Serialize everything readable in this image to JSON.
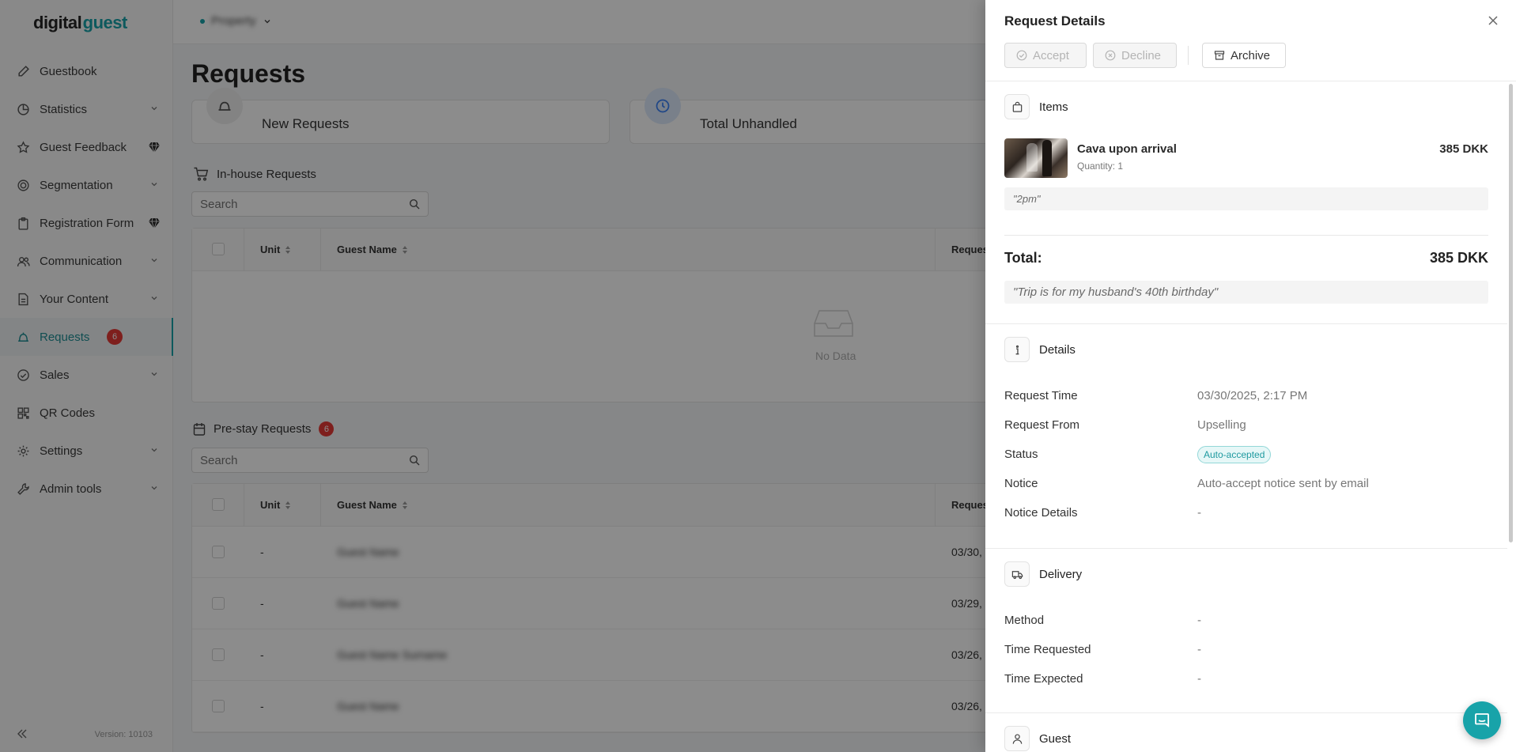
{
  "brand": {
    "logo_main": "digital",
    "logo_accent": "guest"
  },
  "header": {
    "property_name": "Property"
  },
  "sidebar": {
    "items": [
      {
        "label": "Guestbook",
        "icon": "pen-icon"
      },
      {
        "label": "Statistics",
        "icon": "chart-icon"
      },
      {
        "label": "Guest Feedback",
        "icon": "star-icon"
      },
      {
        "label": "Segmentation",
        "icon": "target-icon"
      },
      {
        "label": "Registration Form",
        "icon": "clipboard-icon"
      },
      {
        "label": "Communication",
        "icon": "users-icon"
      },
      {
        "label": "Your Content",
        "icon": "document-icon"
      },
      {
        "label": "Requests",
        "icon": "bell-icon",
        "badge": "6"
      },
      {
        "label": "Sales",
        "icon": "bag-icon"
      },
      {
        "label": "QR Codes",
        "icon": "qr-icon"
      },
      {
        "label": "Settings",
        "icon": "gear-icon"
      },
      {
        "label": "Admin tools",
        "icon": "wrench-icon"
      }
    ],
    "version": "Version: 10103"
  },
  "main": {
    "title": "Requests",
    "cards": {
      "new_requests": "New Requests",
      "total_unhandled": "Total Unhandled"
    },
    "inhouse": {
      "title": "In-house Requests",
      "search_placeholder": "Search",
      "columns": {
        "unit": "Unit",
        "guest_name": "Guest Name",
        "request": "Reques"
      },
      "empty_text": "No Data"
    },
    "prestay": {
      "title": "Pre-stay Requests",
      "badge": "6",
      "search_placeholder": "Search",
      "columns": {
        "unit": "Unit",
        "guest_name": "Guest Name",
        "request": "Reques"
      },
      "rows": [
        {
          "unit": "-",
          "guest_name": "Guest Name",
          "date": "03/30,"
        },
        {
          "unit": "-",
          "guest_name": "Guest Name",
          "date": "03/29,"
        },
        {
          "unit": "-",
          "guest_name": "Guest Name Surname",
          "date": "03/26,"
        },
        {
          "unit": "-",
          "guest_name": "Guest Name",
          "date": "03/26,"
        }
      ]
    }
  },
  "drawer": {
    "title": "Request Details",
    "actions": {
      "accept": "Accept",
      "decline": "Decline",
      "archive": "Archive"
    },
    "items_section": {
      "title": "Items",
      "item_name": "Cava upon arrival",
      "item_quantity": "Quantity: 1",
      "item_price": "385 DKK",
      "item_note": "\"2pm\"",
      "total_label": "Total:",
      "total_value": "385 DKK",
      "order_note": "\"Trip is for my husband's 40th birthday\""
    },
    "details_section": {
      "title": "Details",
      "request_time_label": "Request Time",
      "request_time_value": "03/30/2025, 2:17 PM",
      "request_from_label": "Request From",
      "request_from_value": "Upselling",
      "status_label": "Status",
      "status_value": "Auto-accepted",
      "notice_label": "Notice",
      "notice_value": "Auto-accept notice sent by email",
      "notice_details_label": "Notice Details",
      "notice_details_value": "-"
    },
    "delivery_section": {
      "title": "Delivery",
      "method_label": "Method",
      "method_value": "-",
      "time_requested_label": "Time Requested",
      "time_requested_value": "-",
      "time_expected_label": "Time Expected",
      "time_expected_value": "-"
    },
    "guest_section": {
      "title": "Guest"
    }
  },
  "colors": {
    "accent": "#18a3a9",
    "badge": "#e53935",
    "status_bg": "#e6f7f7"
  }
}
